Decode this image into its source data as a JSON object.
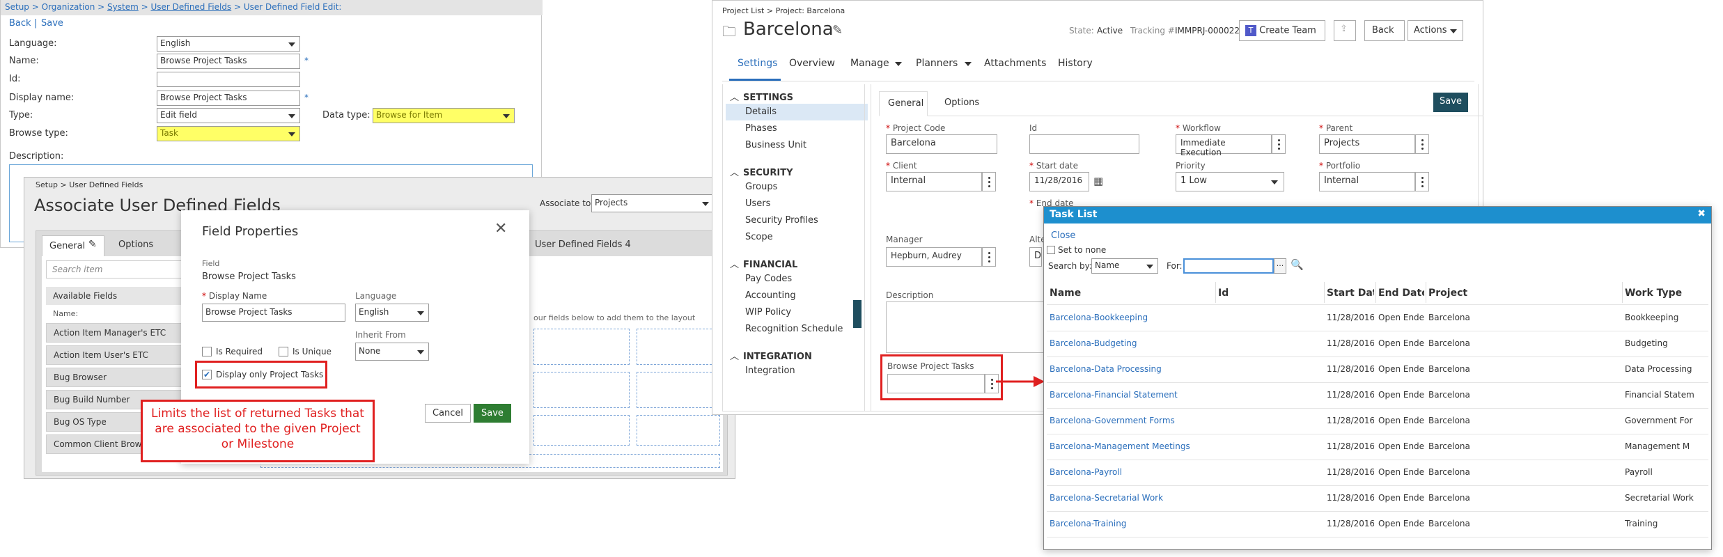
{
  "udf": {
    "breadcrumb": [
      {
        "label": "Setup",
        "link": true
      },
      {
        "label": " > ",
        "link": false
      },
      {
        "label": "Organization",
        "link": true
      },
      {
        "label": " > ",
        "link": false
      },
      {
        "label": "System",
        "link": true
      },
      {
        "label": " > ",
        "link": false
      },
      {
        "label": "User Defined Fields",
        "link": true
      },
      {
        "label": " > User Defined Field Edit:",
        "link": false
      }
    ],
    "back_label": "Back",
    "separator": "|",
    "save_label": "Save",
    "language_label": "Language:",
    "language_value": "English",
    "name_label": "Name:",
    "name_value": "Browse Project Tasks",
    "required_mark": "*",
    "id_label": "Id:",
    "id_value": "",
    "display_name_label": "Display name:",
    "display_name_value": "Browse Project Tasks",
    "type_label": "Type:",
    "type_value": "Edit field",
    "data_type_label": "Data type:",
    "data_type_value": "Browse for Item",
    "browse_type_label": "Browse type:",
    "browse_type_value": "Task",
    "description_label": "Description:"
  },
  "assoc": {
    "breadcrumb": "Setup > User Defined Fields",
    "title": "Associate User Defined Fields",
    "associate_to_label": "Associate to:",
    "associate_to_value": "Projects",
    "tab_general": "General",
    "tab_options": "Options",
    "tab_udf4": "User Defined Fields 4",
    "search_placeholder": "Search item",
    "available_fields_label": "Available Fields",
    "name_col": "Name:",
    "hint_text": "our fields below to add them to the layout",
    "fields": [
      "Action Item Manager's ETC",
      "Action Item User's ETC",
      "Bug Browser",
      "Bug Build Number",
      "Bug OS Type",
      "Common Client Browse"
    ]
  },
  "fp": {
    "title": "Field Properties",
    "field_label": "Field",
    "field_value": "Browse Project Tasks",
    "required_mark": "*",
    "display_name_label": "Display Name",
    "display_name_value": "Browse Project Tasks",
    "language_label": "Language",
    "language_value": "English",
    "inherit_label": "Inherit From",
    "inherit_value": "None",
    "is_required_label": "Is Required",
    "is_unique_label": "Is Unique",
    "display_only_label": "Display only Project Tasks",
    "cancel_label": "Cancel",
    "save_label": "Save",
    "callout_text": "Limits the list of returned Tasks that are associated to the given Project or Milestone"
  },
  "project": {
    "breadcrumb": "Project List > Project: Barcelona",
    "title": "Barcelona",
    "state_label": "State:",
    "state_value": "Active",
    "tracking_label": "Tracking #:",
    "tracking_value": "IMMPRJ-000022",
    "create_team_label": "Create Team",
    "back_label": "Back",
    "actions_label": "Actions",
    "tabs": [
      "Settings",
      "Overview",
      "Manage",
      "Planners",
      "Attachments",
      "History"
    ],
    "sidebar": [
      {
        "header": "SETTINGS",
        "items": [
          "Details",
          "Phases",
          "Business Unit"
        ]
      },
      {
        "header": "SECURITY",
        "items": [
          "Groups",
          "Users",
          "Security Profiles",
          "Scope"
        ]
      },
      {
        "header": "FINANCIAL",
        "items": [
          "Pay Codes",
          "Accounting",
          "WIP Policy",
          "Recognition Schedule"
        ]
      },
      {
        "header": "INTEGRATION",
        "items": [
          "Integration"
        ]
      }
    ],
    "subtab_general": "General",
    "subtab_options": "Options",
    "save_label": "Save",
    "required_mark": "*",
    "project_code_label": "Project Code",
    "project_code_value": "Barcelona",
    "id_label": "Id",
    "id_value": "",
    "workflow_label": "Workflow",
    "workflow_value": "Immediate Execution",
    "parent_label": "Parent",
    "parent_value": "Projects",
    "client_label": "Client",
    "client_value": "Internal",
    "start_date_label": "Start date",
    "start_date_value": "11/28/2016",
    "priority_label": "Priority",
    "priority_value": "1 Low",
    "portfolio_label": "Portfolio",
    "portfolio_value": "Internal",
    "end_date_label": "End date",
    "manager_label": "Manager",
    "manager_value": "Hepburn, Audrey",
    "alt_label": "Alte",
    "alt_value": "D",
    "description_label": "Description",
    "browse_tasks_label": "Browse Project Tasks"
  },
  "tasklist": {
    "title": "Task List",
    "close_label": "Close",
    "set_to_none_label": "Set to none",
    "search_by_label": "Search by:",
    "search_by_value": "Name",
    "for_label": "For:",
    "ellipsis": "...",
    "columns": [
      "Name",
      "Id",
      "Start Date",
      "End Date",
      "Project",
      "Work Type"
    ],
    "rows": [
      {
        "name": "Barcelona-Bookkeeping",
        "id": "",
        "start": "11/28/2016",
        "end": "Open Ended",
        "project": "Barcelona",
        "work_type": "Bookkeeping"
      },
      {
        "name": "Barcelona-Budgeting",
        "id": "",
        "start": "11/28/2016",
        "end": "Open Ended",
        "project": "Barcelona",
        "work_type": "Budgeting"
      },
      {
        "name": "Barcelona-Data Processing",
        "id": "",
        "start": "11/28/2016",
        "end": "Open Ended",
        "project": "Barcelona",
        "work_type": "Data Processing"
      },
      {
        "name": "Barcelona-Financial Statement",
        "id": "",
        "start": "11/28/2016",
        "end": "Open Ended",
        "project": "Barcelona",
        "work_type": "Financial Statem"
      },
      {
        "name": "Barcelona-Government Forms",
        "id": "",
        "start": "11/28/2016",
        "end": "Open Ended",
        "project": "Barcelona",
        "work_type": "Government For"
      },
      {
        "name": "Barcelona-Management Meetings",
        "id": "",
        "start": "11/28/2016",
        "end": "Open Ended",
        "project": "Barcelona",
        "work_type": "Management M"
      },
      {
        "name": "Barcelona-Payroll",
        "id": "",
        "start": "11/28/2016",
        "end": "Open Ended",
        "project": "Barcelona",
        "work_type": "Payroll"
      },
      {
        "name": "Barcelona-Secretarial Work",
        "id": "",
        "start": "11/28/2016",
        "end": "Open Ended",
        "project": "Barcelona",
        "work_type": "Secretarial Work"
      },
      {
        "name": "Barcelona-Training",
        "id": "",
        "start": "11/28/2016",
        "end": "Open Ended",
        "project": "Barcelona",
        "work_type": "Training"
      }
    ]
  },
  "colors": {
    "link": "#2a6ebb",
    "highlight": "#ffff66",
    "callout_red": "#e02020",
    "header_blue": "#1d8fce",
    "save_dark_teal": "#1f4e5f",
    "save_green": "#2e7d32"
  }
}
